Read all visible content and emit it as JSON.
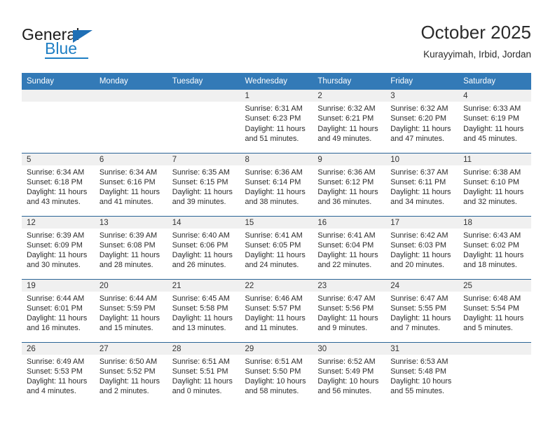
{
  "brand": {
    "name_top": "General",
    "name_bottom": "Blue",
    "triangle_icon": "blue-triangle-icon",
    "accent_color": "#1f7fc4"
  },
  "header": {
    "title": "October 2025",
    "location": "Kurayyimah, Irbid, Jordan"
  },
  "calendar": {
    "header_bg": "#337ab7",
    "row_divider_color": "#2a6496",
    "daynum_band_bg": "#f0f0f0",
    "weekday_headers": [
      "Sunday",
      "Monday",
      "Tuesday",
      "Wednesday",
      "Thursday",
      "Friday",
      "Saturday"
    ],
    "weeks": [
      [
        {
          "day": "",
          "blank": true
        },
        {
          "day": "",
          "blank": true
        },
        {
          "day": "",
          "blank": true
        },
        {
          "day": "1",
          "sunrise": "Sunrise: 6:31 AM",
          "sunset": "Sunset: 6:23 PM",
          "daylight": "Daylight: 11 hours and 51 minutes."
        },
        {
          "day": "2",
          "sunrise": "Sunrise: 6:32 AM",
          "sunset": "Sunset: 6:21 PM",
          "daylight": "Daylight: 11 hours and 49 minutes."
        },
        {
          "day": "3",
          "sunrise": "Sunrise: 6:32 AM",
          "sunset": "Sunset: 6:20 PM",
          "daylight": "Daylight: 11 hours and 47 minutes."
        },
        {
          "day": "4",
          "sunrise": "Sunrise: 6:33 AM",
          "sunset": "Sunset: 6:19 PM",
          "daylight": "Daylight: 11 hours and 45 minutes."
        }
      ],
      [
        {
          "day": "5",
          "sunrise": "Sunrise: 6:34 AM",
          "sunset": "Sunset: 6:18 PM",
          "daylight": "Daylight: 11 hours and 43 minutes."
        },
        {
          "day": "6",
          "sunrise": "Sunrise: 6:34 AM",
          "sunset": "Sunset: 6:16 PM",
          "daylight": "Daylight: 11 hours and 41 minutes."
        },
        {
          "day": "7",
          "sunrise": "Sunrise: 6:35 AM",
          "sunset": "Sunset: 6:15 PM",
          "daylight": "Daylight: 11 hours and 39 minutes."
        },
        {
          "day": "8",
          "sunrise": "Sunrise: 6:36 AM",
          "sunset": "Sunset: 6:14 PM",
          "daylight": "Daylight: 11 hours and 38 minutes."
        },
        {
          "day": "9",
          "sunrise": "Sunrise: 6:36 AM",
          "sunset": "Sunset: 6:12 PM",
          "daylight": "Daylight: 11 hours and 36 minutes."
        },
        {
          "day": "10",
          "sunrise": "Sunrise: 6:37 AM",
          "sunset": "Sunset: 6:11 PM",
          "daylight": "Daylight: 11 hours and 34 minutes."
        },
        {
          "day": "11",
          "sunrise": "Sunrise: 6:38 AM",
          "sunset": "Sunset: 6:10 PM",
          "daylight": "Daylight: 11 hours and 32 minutes."
        }
      ],
      [
        {
          "day": "12",
          "sunrise": "Sunrise: 6:39 AM",
          "sunset": "Sunset: 6:09 PM",
          "daylight": "Daylight: 11 hours and 30 minutes."
        },
        {
          "day": "13",
          "sunrise": "Sunrise: 6:39 AM",
          "sunset": "Sunset: 6:08 PM",
          "daylight": "Daylight: 11 hours and 28 minutes."
        },
        {
          "day": "14",
          "sunrise": "Sunrise: 6:40 AM",
          "sunset": "Sunset: 6:06 PM",
          "daylight": "Daylight: 11 hours and 26 minutes."
        },
        {
          "day": "15",
          "sunrise": "Sunrise: 6:41 AM",
          "sunset": "Sunset: 6:05 PM",
          "daylight": "Daylight: 11 hours and 24 minutes."
        },
        {
          "day": "16",
          "sunrise": "Sunrise: 6:41 AM",
          "sunset": "Sunset: 6:04 PM",
          "daylight": "Daylight: 11 hours and 22 minutes."
        },
        {
          "day": "17",
          "sunrise": "Sunrise: 6:42 AM",
          "sunset": "Sunset: 6:03 PM",
          "daylight": "Daylight: 11 hours and 20 minutes."
        },
        {
          "day": "18",
          "sunrise": "Sunrise: 6:43 AM",
          "sunset": "Sunset: 6:02 PM",
          "daylight": "Daylight: 11 hours and 18 minutes."
        }
      ],
      [
        {
          "day": "19",
          "sunrise": "Sunrise: 6:44 AM",
          "sunset": "Sunset: 6:01 PM",
          "daylight": "Daylight: 11 hours and 16 minutes."
        },
        {
          "day": "20",
          "sunrise": "Sunrise: 6:44 AM",
          "sunset": "Sunset: 5:59 PM",
          "daylight": "Daylight: 11 hours and 15 minutes."
        },
        {
          "day": "21",
          "sunrise": "Sunrise: 6:45 AM",
          "sunset": "Sunset: 5:58 PM",
          "daylight": "Daylight: 11 hours and 13 minutes."
        },
        {
          "day": "22",
          "sunrise": "Sunrise: 6:46 AM",
          "sunset": "Sunset: 5:57 PM",
          "daylight": "Daylight: 11 hours and 11 minutes."
        },
        {
          "day": "23",
          "sunrise": "Sunrise: 6:47 AM",
          "sunset": "Sunset: 5:56 PM",
          "daylight": "Daylight: 11 hours and 9 minutes."
        },
        {
          "day": "24",
          "sunrise": "Sunrise: 6:47 AM",
          "sunset": "Sunset: 5:55 PM",
          "daylight": "Daylight: 11 hours and 7 minutes."
        },
        {
          "day": "25",
          "sunrise": "Sunrise: 6:48 AM",
          "sunset": "Sunset: 5:54 PM",
          "daylight": "Daylight: 11 hours and 5 minutes."
        }
      ],
      [
        {
          "day": "26",
          "sunrise": "Sunrise: 6:49 AM",
          "sunset": "Sunset: 5:53 PM",
          "daylight": "Daylight: 11 hours and 4 minutes."
        },
        {
          "day": "27",
          "sunrise": "Sunrise: 6:50 AM",
          "sunset": "Sunset: 5:52 PM",
          "daylight": "Daylight: 11 hours and 2 minutes."
        },
        {
          "day": "28",
          "sunrise": "Sunrise: 6:51 AM",
          "sunset": "Sunset: 5:51 PM",
          "daylight": "Daylight: 11 hours and 0 minutes."
        },
        {
          "day": "29",
          "sunrise": "Sunrise: 6:51 AM",
          "sunset": "Sunset: 5:50 PM",
          "daylight": "Daylight: 10 hours and 58 minutes."
        },
        {
          "day": "30",
          "sunrise": "Sunrise: 6:52 AM",
          "sunset": "Sunset: 5:49 PM",
          "daylight": "Daylight: 10 hours and 56 minutes."
        },
        {
          "day": "31",
          "sunrise": "Sunrise: 6:53 AM",
          "sunset": "Sunset: 5:48 PM",
          "daylight": "Daylight: 10 hours and 55 minutes."
        },
        {
          "day": "",
          "blank": true
        }
      ]
    ]
  }
}
